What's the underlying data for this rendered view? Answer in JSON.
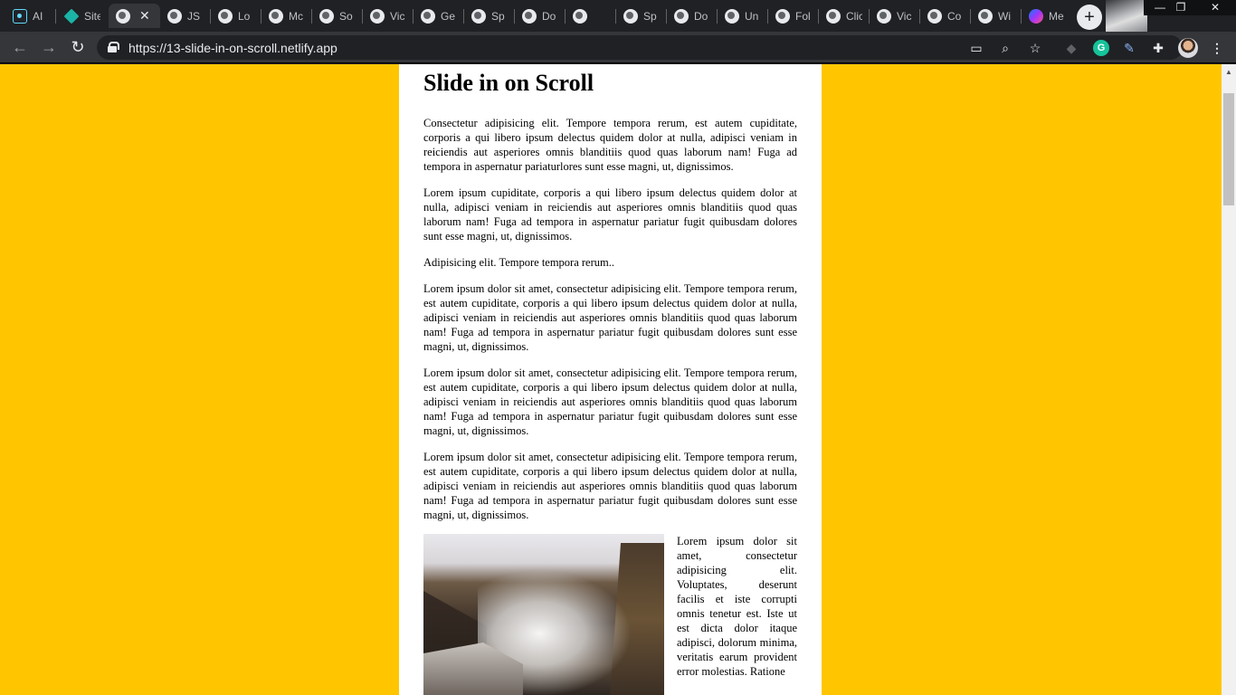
{
  "tabs": [
    {
      "label": "AI",
      "icon": "react-icon"
    },
    {
      "label": "Site",
      "icon": "diamond-icon"
    },
    {
      "label": "",
      "icon": "globe-icon",
      "active": true
    },
    {
      "label": "JS",
      "icon": "globe-icon"
    },
    {
      "label": "Lo",
      "icon": "globe-icon"
    },
    {
      "label": "Mc",
      "icon": "globe-icon"
    },
    {
      "label": "So",
      "icon": "globe-icon"
    },
    {
      "label": "Vic",
      "icon": "globe-icon"
    },
    {
      "label": "Ge",
      "icon": "globe-icon"
    },
    {
      "label": "Sp",
      "icon": "globe-icon"
    },
    {
      "label": "Do",
      "icon": "globe-icon"
    },
    {
      "label": "",
      "icon": "globe-icon"
    },
    {
      "label": "Sp",
      "icon": "globe-icon"
    },
    {
      "label": "Do",
      "icon": "globe-icon"
    },
    {
      "label": "Un",
      "icon": "globe-icon"
    },
    {
      "label": "Fol",
      "icon": "globe-icon"
    },
    {
      "label": "Clic",
      "icon": "globe-icon"
    },
    {
      "label": "Vic",
      "icon": "globe-icon"
    },
    {
      "label": "Co",
      "icon": "globe-icon"
    },
    {
      "label": "Wi",
      "icon": "globe-icon"
    },
    {
      "label": "Me",
      "icon": "messenger-icon"
    }
  ],
  "toolbar": {
    "url": "https://13-slide-in-on-scroll.netlify.app"
  },
  "page": {
    "title": "Slide in on Scroll",
    "paragraphs": [
      "Consectetur adipisicing elit. Tempore tempora rerum, est autem cupiditate, corporis a qui libero ipsum delectus quidem dolor at nulla, adipisci veniam in reiciendis aut asperiores omnis blanditiis quod quas laborum nam! Fuga ad tempora in aspernatur pariaturlores sunt esse magni, ut, dignissimos.",
      "Lorem ipsum cupiditate, corporis a qui libero ipsum delectus quidem dolor at nulla, adipisci veniam in reiciendis aut asperiores omnis blanditiis quod quas laborum nam! Fuga ad tempora in aspernatur pariatur fugit quibusdam dolores sunt esse magni, ut, dignissimos.",
      "Adipisicing elit. Tempore tempora rerum..",
      "Lorem ipsum dolor sit amet, consectetur adipisicing elit. Tempore tempora rerum, est autem cupiditate, corporis a qui libero ipsum delectus quidem dolor at nulla, adipisci veniam in reiciendis aut asperiores omnis blanditiis quod quas laborum nam! Fuga ad tempora in aspernatur pariatur fugit quibusdam dolores sunt esse magni, ut, dignissimos.",
      "Lorem ipsum dolor sit amet, consectetur adipisicing elit. Tempore tempora rerum, est autem cupiditate, corporis a qui libero ipsum delectus quidem dolor at nulla, adipisci veniam in reiciendis aut asperiores omnis blanditiis quod quas laborum nam! Fuga ad tempora in aspernatur pariatur fugit quibusdam dolores sunt esse magni, ut, dignissimos.",
      "Lorem ipsum dolor sit amet, consectetur adipisicing elit. Tempore tempora rerum, est autem cupiditate, corporis a qui libero ipsum delectus quidem dolor at nulla, adipisci veniam in reiciendis aut asperiores omnis blanditiis quod quas laborum nam! Fuga ad tempora in aspernatur pariatur fugit quibusdam dolores sunt esse magni, ut, dignissimos."
    ],
    "side_text": "Lorem ipsum dolor sit amet, consectetur adipisicing elit. Voluptates, deserunt facilis et iste corrupti omnis tenetur est. Iste ut est dicta dolor itaque adipisci, dolorum minima, veritatis earum provident error molestias. Ratione",
    "image": "waterfall-photo"
  },
  "colors": {
    "page_background": "#ffc600",
    "content_background": "#ffffff",
    "browser_frame": "#202124",
    "toolbar": "#35363a"
  }
}
